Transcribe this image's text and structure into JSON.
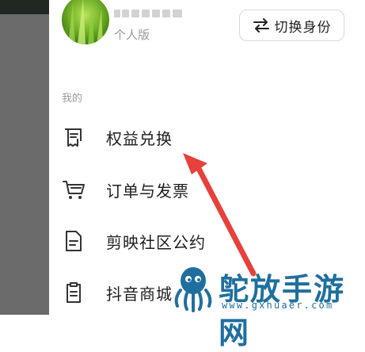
{
  "profile": {
    "subtitle": "个人版"
  },
  "header": {
    "switch_identity_label": "切换身份"
  },
  "section": {
    "title": "我的"
  },
  "menu": [
    {
      "label": "权益兑换",
      "icon": "receipt-icon"
    },
    {
      "label": "订单与发票",
      "icon": "shopping-cart-icon"
    },
    {
      "label": "剪映社区公约",
      "icon": "document-icon"
    },
    {
      "label": "抖音商城",
      "icon": "clipboard-icon"
    }
  ],
  "watermark": {
    "title": "鸵放手游网",
    "url": "www.gxhuaer.com"
  },
  "colors": {
    "arrow": "#e8403a",
    "watermark": "#1f6f9e",
    "left_panel": "#6b6b6b"
  }
}
